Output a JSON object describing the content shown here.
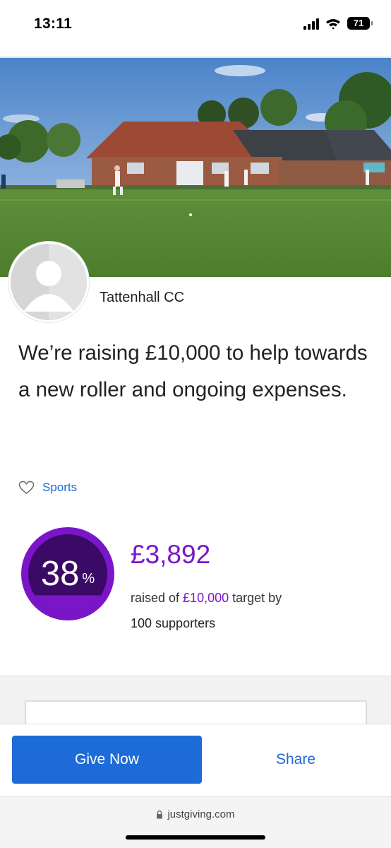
{
  "status_bar": {
    "time": "13:11",
    "battery": "71",
    "signal_icon": "cellular-signal-icon",
    "wifi_icon": "wifi-icon"
  },
  "hero": {
    "image": "cricket-pavilion-photo"
  },
  "page": {
    "organiser": "Tattenhall CC",
    "headline": "We’re raising £10,000 to help towards a new roller and ongoing expenses.",
    "category": "Sports"
  },
  "progress": {
    "percent": "38",
    "percent_sign": "%",
    "percent_value": 38,
    "raised": "£3,892",
    "raised_prefix": "raised of ",
    "target": "£10,000",
    "target_suffix": " target by",
    "supporters": "100 supporters"
  },
  "actions": {
    "give_label": "Give Now",
    "share_label": "Share"
  },
  "browser": {
    "url": "justgiving.com"
  },
  "colors": {
    "brand_blue": "#1c6bd8",
    "accent_purple": "#7a16c8",
    "ring_dark": "#3a0a66"
  }
}
